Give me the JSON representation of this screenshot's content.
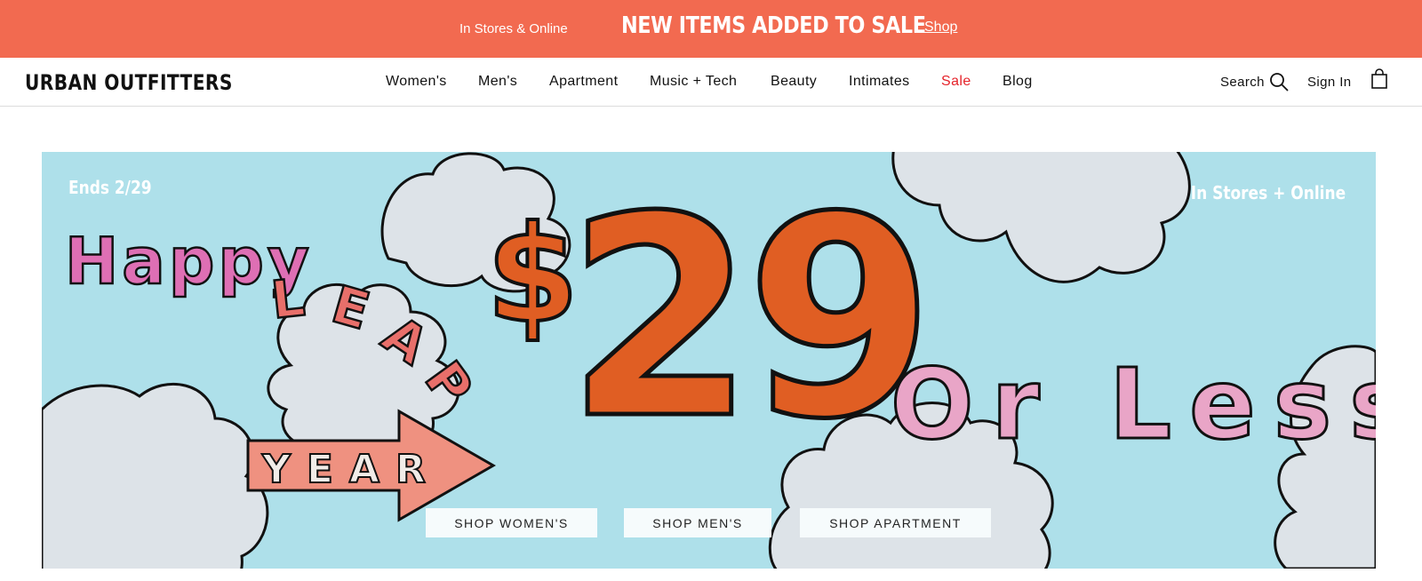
{
  "promo": {
    "sub_label": "In Stores & Online",
    "headline": "NEW ITEMS ADDED TO SALE",
    "shop_link": "Shop",
    "background": "#f26a50"
  },
  "header": {
    "logo": "URBAN OUTFITTERS",
    "nav": [
      "Women's",
      "Men's",
      "Apartment",
      "Music + Tech",
      "Beauty",
      "Intimates",
      "Sale",
      "Blog"
    ],
    "sale_color": "#e5232a",
    "search_label": "Search",
    "search_icon": "search-icon",
    "sign_in_label": "Sign In",
    "bag_icon": "shopping-bag-icon"
  },
  "hero": {
    "ends": "Ends 2/29",
    "in_stores": "In Stores + Online",
    "happy": "Happy",
    "leap": [
      "L",
      "E",
      "A",
      "P"
    ],
    "year": "YEAR",
    "dollar": "$",
    "price": "29",
    "or_less": "Or Less",
    "background": "#aee0ea",
    "price_color": "#e05e23",
    "pink": "#e9a5c7",
    "ctas": [
      "SHOP WOMEN'S",
      "SHOP MEN'S",
      "SHOP APARTMENT"
    ]
  }
}
